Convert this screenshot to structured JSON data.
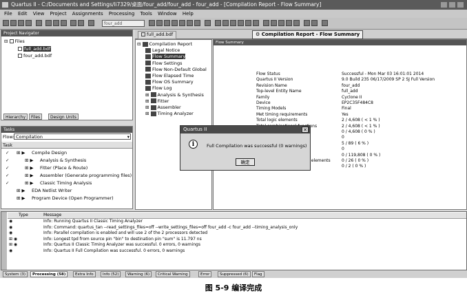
{
  "window": {
    "title": "Quartus II - C:/Documents and Settings/li7329/桌面/four_add/four_add - four_add - [Compilation Report - Flow Summary]"
  },
  "menu": [
    "File",
    "Edit",
    "View",
    "Project",
    "Assignments",
    "Processing",
    "Tools",
    "Window",
    "Help"
  ],
  "toolbar": {
    "entity_combo": "four_add"
  },
  "project_navigator": {
    "title": "Project Navigator",
    "root": "Files",
    "files": [
      "full_add.bdf",
      "four_add.bdf"
    ],
    "tabs": [
      "Hierarchy",
      "Files",
      "Design Units"
    ]
  },
  "tasks": {
    "title": "Tasks",
    "flow_label": "Flow:",
    "flow_value": "Compilation",
    "header": "Task",
    "items": [
      {
        "mark": "✓",
        "label": "Compile Design"
      },
      {
        "mark": "✓",
        "label": "Analysis & Synthesis"
      },
      {
        "mark": "✓",
        "label": "Fitter (Place & Route)"
      },
      {
        "mark": "✓",
        "label": "Assembler (Generate programming files)"
      },
      {
        "mark": "✓",
        "label": "Classic Timing Analysis"
      },
      {
        "mark": "",
        "label": "EDA Netlist Writer"
      },
      {
        "mark": "",
        "label": "Program Device (Open Programmer)"
      }
    ]
  },
  "doc_tabs": {
    "tab1": "full_add.bdf",
    "tab2": "Compilation Report - Flow Summary"
  },
  "report_tree": [
    "Compilation Report",
    "Legal Notice",
    "Flow Summary",
    "Flow Settings",
    "Flow Non-Default Global",
    "Flow Elapsed Time",
    "Flow OS Summary",
    "Flow Log",
    "Analysis & Synthesis",
    "Fitter",
    "Assembler",
    "Timing Analyzer"
  ],
  "flow_summary": {
    "title": "Flow Summary",
    "rows": [
      {
        "k": "Flow Status",
        "v": "Successful - Mon Mar 03 16:01:01 2014"
      },
      {
        "k": "Quartus II Version",
        "v": "9.0 Build 235 06/17/2009 SP 2 SJ Full Version"
      },
      {
        "k": "Revision Name",
        "v": "four_add"
      },
      {
        "k": "Top-level Entity Name",
        "v": "full_add"
      },
      {
        "k": "Family",
        "v": "Cyclone II"
      },
      {
        "k": "Device",
        "v": "EP2C35F484C8"
      },
      {
        "k": "Timing Models",
        "v": "Final"
      },
      {
        "k": "Met timing requirements",
        "v": "Yes"
      },
      {
        "k": "Total logic elements",
        "v": "2 / 4,608 ( < 1 % )"
      },
      {
        "k": "Total combinational functions",
        "v": "2 / 4,608 ( < 1 % )"
      },
      {
        "k": "Dedicated logic registers",
        "v": "0 / 4,608 ( 0 % )"
      },
      {
        "k": "Total registers",
        "v": "0"
      },
      {
        "k": "Total pins",
        "v": "5 / 89 ( 6 % )"
      },
      {
        "k": "Total virtual pins",
        "v": "0"
      },
      {
        "k": "Total memory bits",
        "v": "0 / 119,808 ( 0 % )"
      },
      {
        "k": "Embedded Multiplier 9-bit elements",
        "v": "0 / 26 ( 0 % )"
      },
      {
        "k": "Total PLLs",
        "v": "0 / 2 ( 0 % )"
      }
    ]
  },
  "dialog": {
    "title": "Quartus II",
    "message": "Full Compilation was successful (0 warnings)",
    "ok": "确定"
  },
  "messages": {
    "col_type": "Type",
    "col_message": "Message",
    "lines": [
      "Info: Running Quartus II Classic Timing Analyzer",
      "Info: Command: quartus_tan --read_settings_files=off --write_settings_files=off four_add -c four_add --timing_analysis_only",
      "Info: Parallel compilation is enabled and will use 2 of the 2 processors detected",
      "Info: Longest tpd from source pin \"bin\" to destination pin \"sum\" is 11.797 ns",
      "Info: Quartus II Classic Timing Analyzer was successful. 0 errors, 0 warnings",
      "Info: Quartus II Full Compilation was successful. 0 errors, 0 warnings"
    ],
    "tabs": [
      "System (3)",
      "Processing (58)",
      "Extra Info",
      "Info (52)",
      "Warning (6)",
      "Critical Warning",
      "Error",
      "Suppressed (6)",
      "Flag"
    ]
  },
  "caption": "图 5-9   编译完成"
}
